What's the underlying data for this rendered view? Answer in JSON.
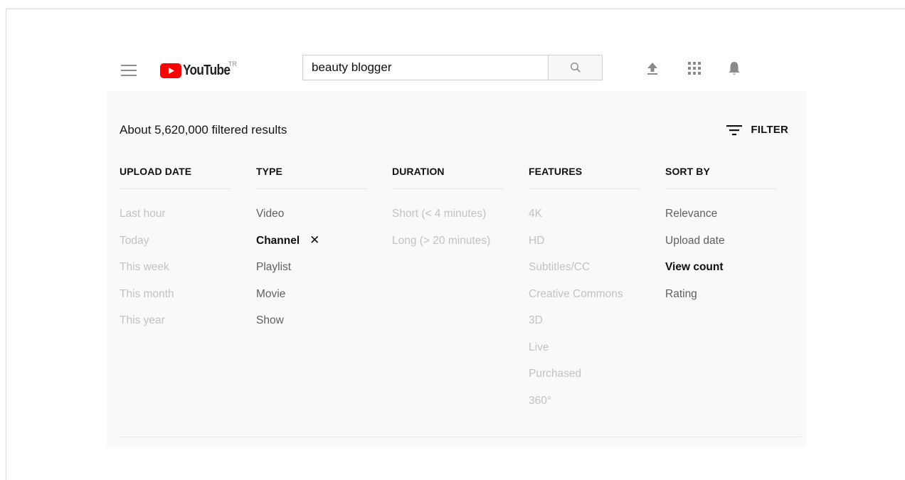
{
  "header": {
    "logo_text": "YouTube",
    "region": "TR",
    "search_value": "beauty blogger",
    "icons": [
      "menu-icon",
      "search-icon",
      "upload-icon",
      "apps-icon",
      "notifications-icon"
    ]
  },
  "results": {
    "count_text": "About 5,620,000 filtered results",
    "filter_label": "FILTER"
  },
  "columns": [
    {
      "heading": "UPLOAD DATE",
      "options": [
        {
          "label": "Last hour",
          "state": "disabled"
        },
        {
          "label": "Today",
          "state": "disabled"
        },
        {
          "label": "This week",
          "state": "disabled"
        },
        {
          "label": "This month",
          "state": "disabled"
        },
        {
          "label": "This year",
          "state": "disabled"
        }
      ]
    },
    {
      "heading": "TYPE",
      "options": [
        {
          "label": "Video",
          "state": "enabled"
        },
        {
          "label": "Channel",
          "state": "active"
        },
        {
          "label": "Playlist",
          "state": "enabled"
        },
        {
          "label": "Movie",
          "state": "enabled"
        },
        {
          "label": "Show",
          "state": "enabled"
        }
      ]
    },
    {
      "heading": "DURATION",
      "options": [
        {
          "label": "Short (< 4 minutes)",
          "state": "disabled"
        },
        {
          "label": "Long (> 20 minutes)",
          "state": "disabled"
        }
      ]
    },
    {
      "heading": "FEATURES",
      "options": [
        {
          "label": "4K",
          "state": "disabled"
        },
        {
          "label": "HD",
          "state": "disabled"
        },
        {
          "label": "Subtitles/CC",
          "state": "disabled"
        },
        {
          "label": "Creative Commons",
          "state": "disabled"
        },
        {
          "label": "3D",
          "state": "disabled"
        },
        {
          "label": "Live",
          "state": "disabled"
        },
        {
          "label": "Purchased",
          "state": "disabled"
        },
        {
          "label": "360°",
          "state": "disabled"
        }
      ]
    },
    {
      "heading": "SORT BY",
      "options": [
        {
          "label": "Relevance",
          "state": "enabled"
        },
        {
          "label": "Upload date",
          "state": "enabled"
        },
        {
          "label": "View count",
          "state": "active"
        },
        {
          "label": "Rating",
          "state": "enabled"
        }
      ]
    }
  ],
  "colors": {
    "brand_red": "#ff0000",
    "panel_bg": "#f9f9f9",
    "disabled_text": "#c2c2c2",
    "enabled_text": "#606060",
    "active_text": "#0f0f0f"
  }
}
